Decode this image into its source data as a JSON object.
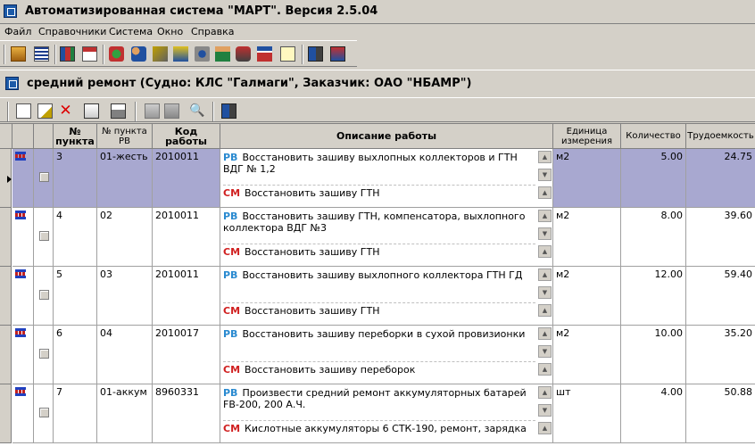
{
  "window": {
    "title": "Автоматизированная система \"МАРТ\". Версия 2.5.04"
  },
  "menu": [
    "Файл",
    "Справочники",
    "Система",
    "Окно",
    "Справка"
  ],
  "inner_window": {
    "title": "средний ремонт (Судно: КЛС \"Галмаги\", Заказчик: ОАО \"НБАМР\")"
  },
  "columns": {
    "punkt": "№ пункта",
    "punkt_rv": "№ пункта РВ",
    "kod": "Код работы",
    "opisanie": "Описание работы",
    "edinica": "Единица измерения",
    "kolichestvo": "Количество",
    "trudoemkost": "Трудоемкость"
  },
  "tags": {
    "rv": "РВ",
    "sm": "СМ"
  },
  "rows": [
    {
      "punkt": "3",
      "punkt_rv": "01-жесть",
      "kod": "2010011",
      "rv_text": "Восстановить зашиву выхлопных коллекторов и ГТН ВДГ № 1,2",
      "sm_text": "Восстановить зашиву ГТН",
      "edinica": "м2",
      "kolichestvo": "5.00",
      "trudoemkost": "24.75",
      "selected": true
    },
    {
      "punkt": "4",
      "punkt_rv": "02",
      "kod": "2010011",
      "rv_text": "Восстановить зашиву ГТН, компенсатора, выхлопного коллектора ВДГ №3",
      "sm_text": "Восстановить зашиву ГТН",
      "edinica": "м2",
      "kolichestvo": "8.00",
      "trudoemkost": "39.60",
      "selected": false
    },
    {
      "punkt": "5",
      "punkt_rv": "03",
      "kod": "2010011",
      "rv_text": "Восстановить зашиву выхлопного коллектора ГТН ГД",
      "sm_text": "Восстановить зашиву ГТН",
      "edinica": "м2",
      "kolichestvo": "12.00",
      "trudoemkost": "59.40",
      "selected": false
    },
    {
      "punkt": "6",
      "punkt_rv": "04",
      "kod": "2010017",
      "rv_text": "Восстановить зашиву переборки в сухой провизионки",
      "sm_text": "Восстановить зашиву переборок",
      "edinica": "м2",
      "kolichestvo": "10.00",
      "trudoemkost": "35.20",
      "selected": false
    },
    {
      "punkt": "7",
      "punkt_rv": "01-аккум",
      "kod": "8960331",
      "rv_text": "Произвести средний ремонт аккумуляторных батарей FB-200, 200 А.Ч.",
      "sm_text": "Кислотные  аккумуляторы 6 СТК-190, ремонт, зарядка",
      "edinica": "шт",
      "kolichestvo": "4.00",
      "trudoemkost": "50.88",
      "selected": false
    }
  ],
  "colors": {
    "selection": "#a8a8d0",
    "rv_tag": "#2a8ad0",
    "sm_tag": "#d02020",
    "window_bg": "#d4d0c8"
  }
}
